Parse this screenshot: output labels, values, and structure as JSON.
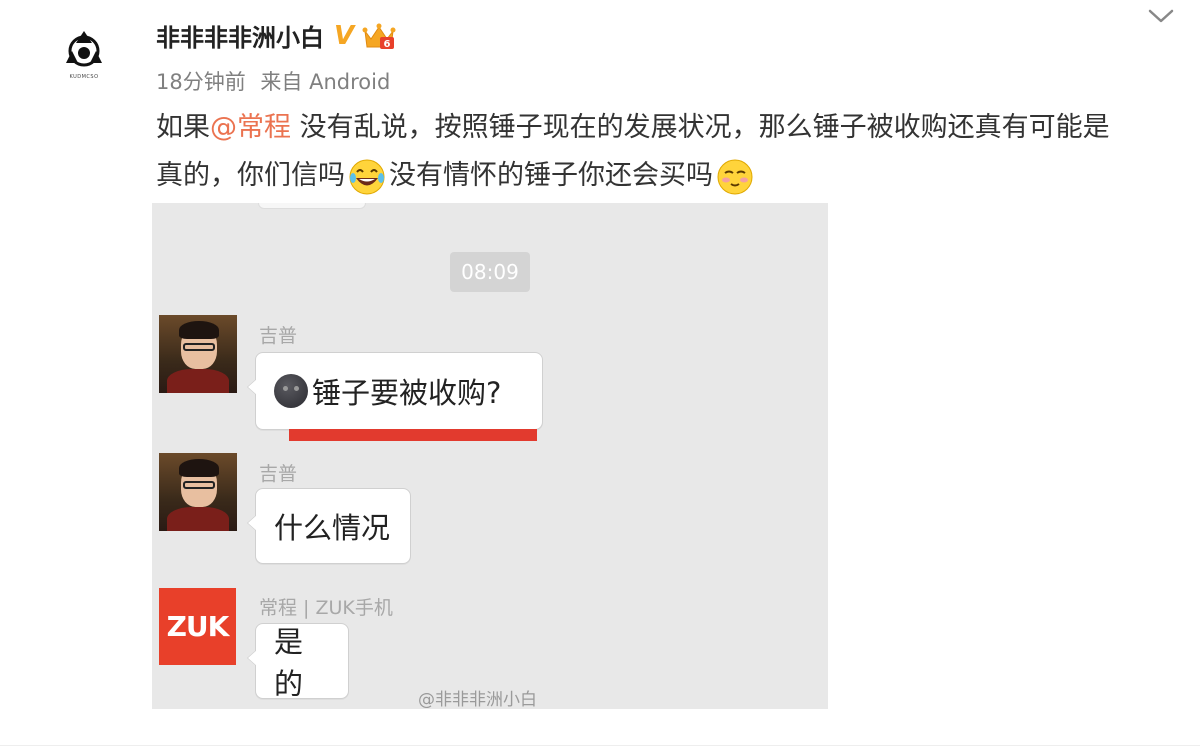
{
  "post": {
    "username": "非非非非洲小白",
    "verified_badge": "V",
    "time_ago": "18分钟前",
    "source": "来自 Android",
    "text_before_mention": "如果",
    "mention": "@常程",
    "text_line1_rest": " 没有乱说，按照锤子现在的发展状况，那么锤子被收购还真有可能是",
    "text_line2_part1": "真的，你们信吗",
    "text_line2_part2": "没有情怀的锤子你还会买吗",
    "avatar_logo_text": "KUDMCSO",
    "icons": {
      "menu": "chevron-down-icon",
      "verified": "verified-v-icon",
      "crown": "vip-crown-icon",
      "emoji_laugh": "laughing-tears-emoji",
      "emoji_sly": "sly-face-emoji"
    },
    "colors": {
      "mention": "#eb7350",
      "verified": "#f5a623",
      "zuk": "#e8402a"
    }
  },
  "chat": {
    "time": "08:09",
    "messages": [
      {
        "sender": "吉普",
        "text": "锤子要被收购?",
        "has_dark_emoji": true
      },
      {
        "sender": "吉普",
        "text": "什么情况",
        "has_dark_emoji": false
      },
      {
        "sender": "常程 | ZUK手机",
        "text": "是的",
        "has_dark_emoji": false
      }
    ],
    "zuk_logo": "ZUK",
    "watermark": "@非非非洲小白"
  }
}
